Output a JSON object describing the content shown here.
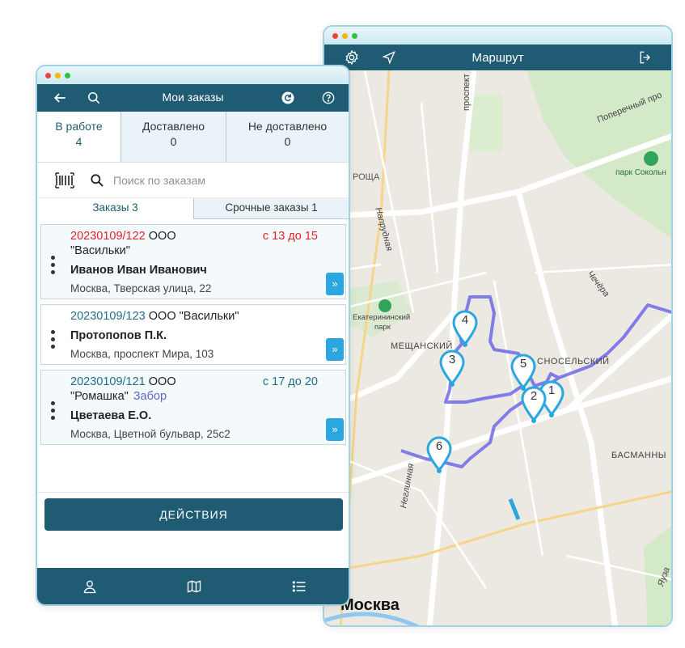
{
  "map_window": {
    "header_title": "Маршрут",
    "labels": {
      "prospect": "проспект",
      "poperechny": "Поперечный про",
      "park_sokolniki": "парк Сокольн",
      "roscha": "РОЩА",
      "naprudnaya": "Напрудная",
      "chechera": "Чечёра",
      "ekaterininsky": "Екатерининский",
      "park": "парк",
      "meshchansky": "МЕЩАНСКИЙ",
      "krasnoselsky": "СНОСЕЛЬСКИЙ",
      "basmanny": "БАСМАННЫ",
      "neglinnaya": "Неглинная",
      "yauza": "Яуза",
      "moskva": "Москва"
    },
    "pins": [
      "1",
      "2",
      "3",
      "4",
      "5",
      "6"
    ],
    "colors": {
      "route": "#6e6ae8",
      "pin": "#2aa6e0",
      "header": "#1f5c74"
    }
  },
  "orders_window": {
    "header_title": "Мои заказы",
    "status_tabs": [
      {
        "label": "В работе",
        "count": "4"
      },
      {
        "label": "Доставлено",
        "count": "0"
      },
      {
        "label": "Не доставлено",
        "count": "0"
      }
    ],
    "search_placeholder": "Поиск по заказам",
    "sub_tabs": [
      "Заказы 3",
      "Срочные заказы 1"
    ],
    "orders": [
      {
        "number": "20230109/122",
        "org": "ООО",
        "org2": "\"Васильки\"",
        "time": "с 13 до 15",
        "person": "Иванов Иван Иванович",
        "address": "Москва, Тверская улица, 22"
      },
      {
        "number": "20230109/123",
        "org": "ООО \"Васильки\"",
        "person": "Протопопов П.К.",
        "address": "Москва, проспект Мира, 103"
      },
      {
        "number": "20230109/121",
        "org": "ООО",
        "org2": "\"Ромашка\"",
        "badge": "Забор",
        "time": "с 17 до 20",
        "person": "Цветаева Е.О.",
        "address": "Москва, Цветной бульвар, 25с2"
      }
    ],
    "actions_label": "ДЕЙСТВИЯ"
  }
}
